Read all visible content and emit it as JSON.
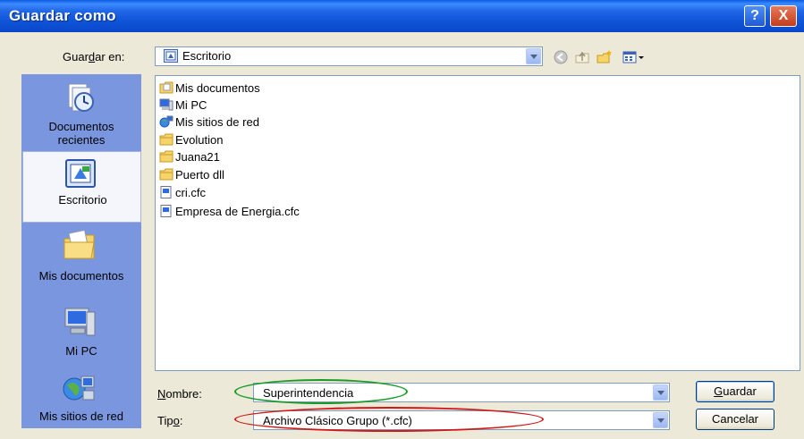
{
  "window": {
    "title": "Guardar como"
  },
  "titlebar": {
    "help_label": "?",
    "close_label": "X"
  },
  "save_in": {
    "label_pre": "Guar",
    "label_key": "d",
    "label_post": "ar en:",
    "location": "Escritorio"
  },
  "toolbar": {
    "icons": [
      "back-icon",
      "up-folder-icon",
      "new-folder-icon",
      "views-menu-icon"
    ]
  },
  "places": [
    {
      "id": "recent",
      "label": "Documentos\nrecientes",
      "icon": "recent-documents-icon"
    },
    {
      "id": "desktop",
      "label": "Escritorio",
      "icon": "desktop-icon",
      "selected": true
    },
    {
      "id": "mydocs",
      "label": "Mis documentos",
      "icon": "my-documents-icon"
    },
    {
      "id": "mypc",
      "label": "Mi PC",
      "icon": "my-computer-icon"
    },
    {
      "id": "network",
      "label": "Mis sitios de red",
      "icon": "network-places-icon"
    }
  ],
  "files": [
    {
      "name": "Mis documentos",
      "icon": "my-documents-folder-icon"
    },
    {
      "name": "Mi PC",
      "icon": "my-computer-icon"
    },
    {
      "name": "Mis sitios de red",
      "icon": "network-places-icon"
    },
    {
      "name": "Evolution",
      "icon": "folder-icon"
    },
    {
      "name": "Juana21",
      "icon": "folder-icon"
    },
    {
      "name": "Puerto dll",
      "icon": "folder-icon"
    },
    {
      "name": "cri.cfc",
      "icon": "cfc-file-icon"
    },
    {
      "name": "Empresa de Energia.cfc",
      "icon": "cfc-file-icon"
    }
  ],
  "filename": {
    "label_key": "N",
    "label_post": "ombre:",
    "value": "Superintendencia",
    "highlight_color": "#1a9a2a"
  },
  "filetype": {
    "label_pre": "Tip",
    "label_key": "o",
    "label_post": ":",
    "value": "Archivo Clásico Grupo (*.cfc)",
    "highlight_color": "#d01818"
  },
  "buttons": {
    "save_key": "G",
    "save_post": "uardar",
    "cancel": "Cancelar"
  }
}
